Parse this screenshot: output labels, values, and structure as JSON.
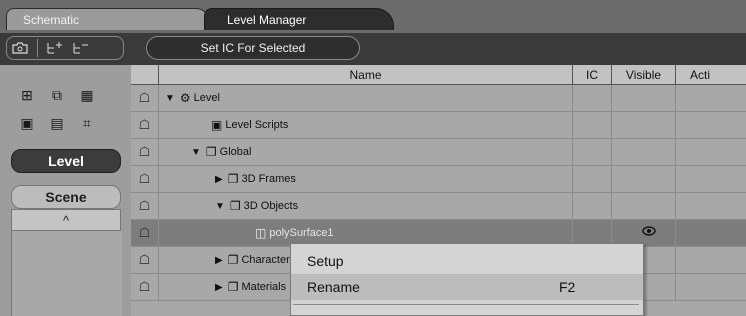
{
  "tabs": [
    {
      "label": "Schematic",
      "active": false
    },
    {
      "label": "Level Manager",
      "active": true
    }
  ],
  "toolbar": {
    "icons": [
      "camera-icon",
      "expand-tree-icon",
      "collapse-tree-icon"
    ],
    "set_ic_label": "Set IC For Selected"
  },
  "left_panel": {
    "icon_rows": [
      [
        "grid-view-icon",
        "copy-view-icon",
        "table-view-icon"
      ],
      [
        "film-icon",
        "monitor-icon",
        "hierarchy-icon"
      ]
    ],
    "level_label": "Level",
    "scene_label": "Scene",
    "collapse_label": "^"
  },
  "grid": {
    "columns": [
      "Name",
      "IC",
      "Visible",
      "Acti"
    ],
    "rows": [
      {
        "label": "Level",
        "expander": "▼",
        "icon": "level-icon",
        "selected": false,
        "visible": false
      },
      {
        "label": "Level Scripts",
        "expander": "",
        "icon": "script-icon",
        "selected": false,
        "visible": false
      },
      {
        "label": "Global",
        "expander": "▼",
        "icon": "folder-icon",
        "selected": false,
        "visible": false
      },
      {
        "label": "3D Frames",
        "expander": "▶",
        "icon": "folder-icon",
        "selected": false,
        "visible": false
      },
      {
        "label": "3D Objects",
        "expander": "▼",
        "icon": "folder-icon",
        "selected": false,
        "visible": false
      },
      {
        "label": "polySurface1",
        "expander": "",
        "icon": "mesh-icon",
        "selected": true,
        "visible": true
      },
      {
        "label": "Characters",
        "expander": "▶",
        "icon": "folder-icon",
        "selected": false,
        "visible": false
      },
      {
        "label": "Materials",
        "expander": "▶",
        "icon": "folder-icon",
        "selected": false,
        "visible": false
      }
    ]
  },
  "context_menu": {
    "items": [
      {
        "label": "Setup",
        "shortcut": ""
      },
      {
        "label": "Rename",
        "shortcut": "F2"
      }
    ]
  }
}
